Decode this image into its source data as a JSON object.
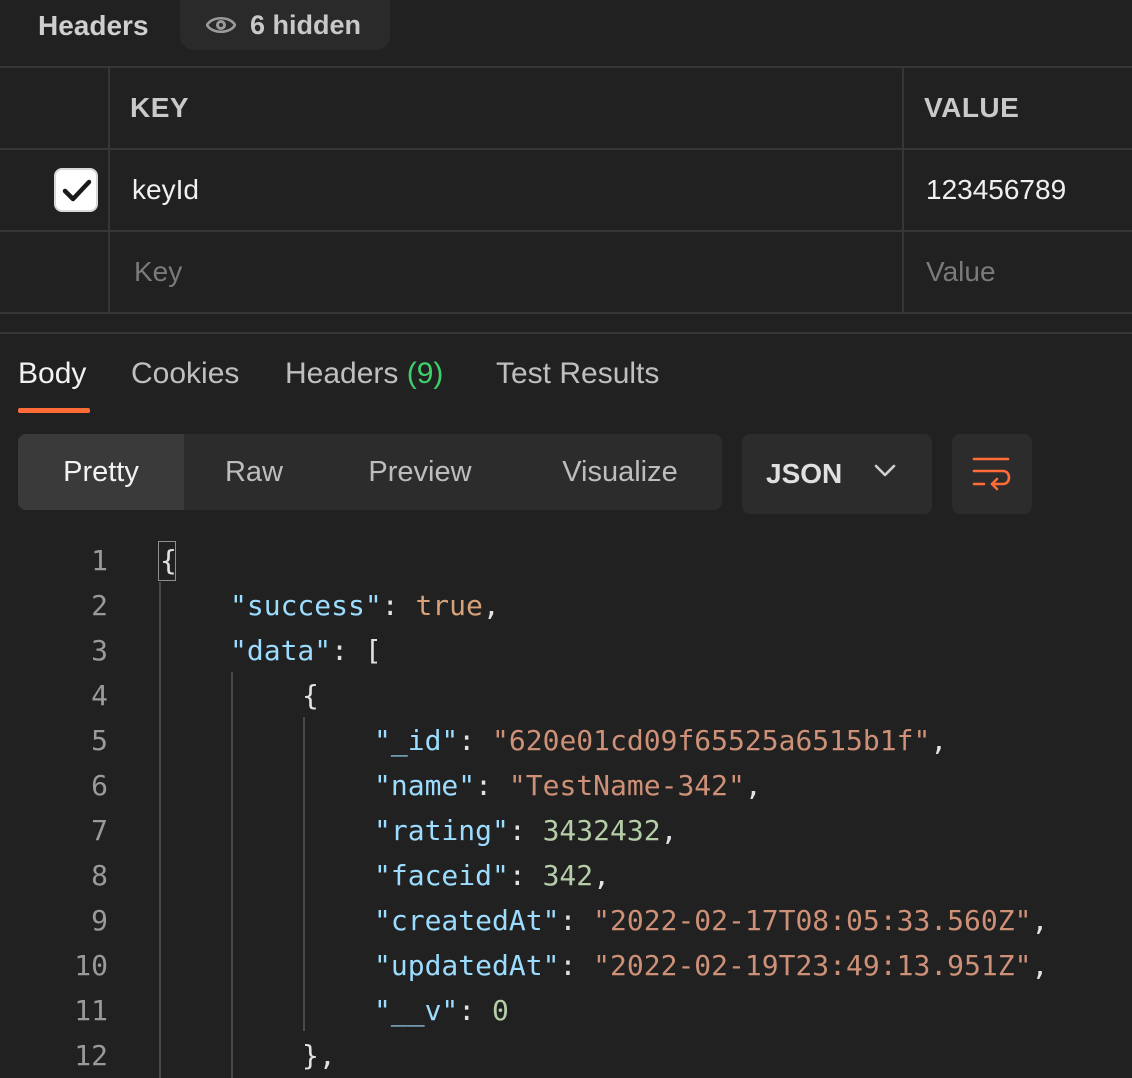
{
  "headers_section": {
    "title": "Headers",
    "hidden_label": "6 hidden",
    "columns": {
      "key": "KEY",
      "value": "VALUE"
    },
    "rows": [
      {
        "checked": true,
        "key": "keyId",
        "value": "123456789"
      }
    ],
    "placeholder": {
      "key": "Key",
      "value": "Value"
    }
  },
  "response_tabs": {
    "items": [
      {
        "label": "Body",
        "active": true
      },
      {
        "label": "Cookies",
        "active": false
      },
      {
        "label": "Headers",
        "count": "(9)",
        "active": false
      },
      {
        "label": "Test Results",
        "active": false
      }
    ]
  },
  "view_modes": {
    "items": [
      "Pretty",
      "Raw",
      "Preview",
      "Visualize"
    ],
    "active": "Pretty"
  },
  "format_select": {
    "selected": "JSON"
  },
  "code": {
    "line_numbers": [
      "1",
      "2",
      "3",
      "4",
      "5",
      "6",
      "7",
      "8",
      "9",
      "10",
      "11",
      "12"
    ],
    "open_brace": "{",
    "success_key": "\"success\"",
    "success_value": "true",
    "data_key": "\"data\"",
    "data_open": "[",
    "item_open": "{",
    "fields": [
      {
        "key": "\"_id\"",
        "value": "\"620e01cd09f65525a6515b1f\"",
        "type": "string"
      },
      {
        "key": "\"name\"",
        "value": "\"TestName-342\"",
        "type": "string"
      },
      {
        "key": "\"rating\"",
        "value": "3432432",
        "type": "number"
      },
      {
        "key": "\"faceid\"",
        "value": "342",
        "type": "number"
      },
      {
        "key": "\"createdAt\"",
        "value": "\"2022-02-17T08:05:33.560Z\"",
        "type": "string"
      },
      {
        "key": "\"updatedAt\"",
        "value": "\"2022-02-19T23:49:13.951Z\"",
        "type": "string"
      },
      {
        "key": "\"__v\"",
        "value": "0",
        "type": "number"
      }
    ],
    "item_close": "},"
  },
  "colors": {
    "accent": "#ff6c37",
    "count_green": "#3ecf6b",
    "json_key": "#9cdcfe",
    "json_string": "#ce9178",
    "json_number": "#b5cea8"
  },
  "icons": [
    "eye-icon",
    "check-icon",
    "chevron-down-icon",
    "wrap-lines-icon"
  ]
}
